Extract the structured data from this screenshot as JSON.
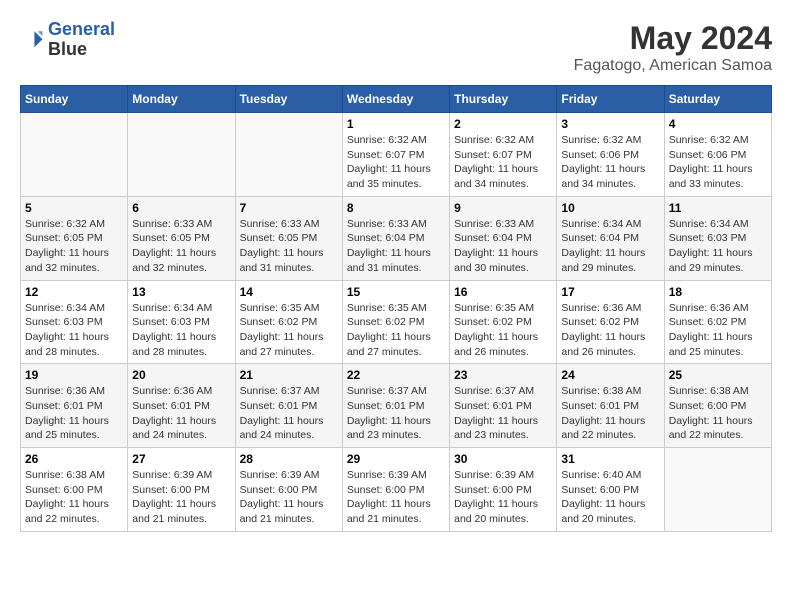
{
  "header": {
    "logo_line1": "General",
    "logo_line2": "Blue",
    "month": "May 2024",
    "location": "Fagatogo, American Samoa"
  },
  "weekdays": [
    "Sunday",
    "Monday",
    "Tuesday",
    "Wednesday",
    "Thursday",
    "Friday",
    "Saturday"
  ],
  "weeks": [
    [
      {
        "day": "",
        "info": ""
      },
      {
        "day": "",
        "info": ""
      },
      {
        "day": "",
        "info": ""
      },
      {
        "day": "1",
        "info": "Sunrise: 6:32 AM\nSunset: 6:07 PM\nDaylight: 11 hours\nand 35 minutes."
      },
      {
        "day": "2",
        "info": "Sunrise: 6:32 AM\nSunset: 6:07 PM\nDaylight: 11 hours\nand 34 minutes."
      },
      {
        "day": "3",
        "info": "Sunrise: 6:32 AM\nSunset: 6:06 PM\nDaylight: 11 hours\nand 34 minutes."
      },
      {
        "day": "4",
        "info": "Sunrise: 6:32 AM\nSunset: 6:06 PM\nDaylight: 11 hours\nand 33 minutes."
      }
    ],
    [
      {
        "day": "5",
        "info": "Sunrise: 6:32 AM\nSunset: 6:05 PM\nDaylight: 11 hours\nand 32 minutes."
      },
      {
        "day": "6",
        "info": "Sunrise: 6:33 AM\nSunset: 6:05 PM\nDaylight: 11 hours\nand 32 minutes."
      },
      {
        "day": "7",
        "info": "Sunrise: 6:33 AM\nSunset: 6:05 PM\nDaylight: 11 hours\nand 31 minutes."
      },
      {
        "day": "8",
        "info": "Sunrise: 6:33 AM\nSunset: 6:04 PM\nDaylight: 11 hours\nand 31 minutes."
      },
      {
        "day": "9",
        "info": "Sunrise: 6:33 AM\nSunset: 6:04 PM\nDaylight: 11 hours\nand 30 minutes."
      },
      {
        "day": "10",
        "info": "Sunrise: 6:34 AM\nSunset: 6:04 PM\nDaylight: 11 hours\nand 29 minutes."
      },
      {
        "day": "11",
        "info": "Sunrise: 6:34 AM\nSunset: 6:03 PM\nDaylight: 11 hours\nand 29 minutes."
      }
    ],
    [
      {
        "day": "12",
        "info": "Sunrise: 6:34 AM\nSunset: 6:03 PM\nDaylight: 11 hours\nand 28 minutes."
      },
      {
        "day": "13",
        "info": "Sunrise: 6:34 AM\nSunset: 6:03 PM\nDaylight: 11 hours\nand 28 minutes."
      },
      {
        "day": "14",
        "info": "Sunrise: 6:35 AM\nSunset: 6:02 PM\nDaylight: 11 hours\nand 27 minutes."
      },
      {
        "day": "15",
        "info": "Sunrise: 6:35 AM\nSunset: 6:02 PM\nDaylight: 11 hours\nand 27 minutes."
      },
      {
        "day": "16",
        "info": "Sunrise: 6:35 AM\nSunset: 6:02 PM\nDaylight: 11 hours\nand 26 minutes."
      },
      {
        "day": "17",
        "info": "Sunrise: 6:36 AM\nSunset: 6:02 PM\nDaylight: 11 hours\nand 26 minutes."
      },
      {
        "day": "18",
        "info": "Sunrise: 6:36 AM\nSunset: 6:02 PM\nDaylight: 11 hours\nand 25 minutes."
      }
    ],
    [
      {
        "day": "19",
        "info": "Sunrise: 6:36 AM\nSunset: 6:01 PM\nDaylight: 11 hours\nand 25 minutes."
      },
      {
        "day": "20",
        "info": "Sunrise: 6:36 AM\nSunset: 6:01 PM\nDaylight: 11 hours\nand 24 minutes."
      },
      {
        "day": "21",
        "info": "Sunrise: 6:37 AM\nSunset: 6:01 PM\nDaylight: 11 hours\nand 24 minutes."
      },
      {
        "day": "22",
        "info": "Sunrise: 6:37 AM\nSunset: 6:01 PM\nDaylight: 11 hours\nand 23 minutes."
      },
      {
        "day": "23",
        "info": "Sunrise: 6:37 AM\nSunset: 6:01 PM\nDaylight: 11 hours\nand 23 minutes."
      },
      {
        "day": "24",
        "info": "Sunrise: 6:38 AM\nSunset: 6:01 PM\nDaylight: 11 hours\nand 22 minutes."
      },
      {
        "day": "25",
        "info": "Sunrise: 6:38 AM\nSunset: 6:00 PM\nDaylight: 11 hours\nand 22 minutes."
      }
    ],
    [
      {
        "day": "26",
        "info": "Sunrise: 6:38 AM\nSunset: 6:00 PM\nDaylight: 11 hours\nand 22 minutes."
      },
      {
        "day": "27",
        "info": "Sunrise: 6:39 AM\nSunset: 6:00 PM\nDaylight: 11 hours\nand 21 minutes."
      },
      {
        "day": "28",
        "info": "Sunrise: 6:39 AM\nSunset: 6:00 PM\nDaylight: 11 hours\nand 21 minutes."
      },
      {
        "day": "29",
        "info": "Sunrise: 6:39 AM\nSunset: 6:00 PM\nDaylight: 11 hours\nand 21 minutes."
      },
      {
        "day": "30",
        "info": "Sunrise: 6:39 AM\nSunset: 6:00 PM\nDaylight: 11 hours\nand 20 minutes."
      },
      {
        "day": "31",
        "info": "Sunrise: 6:40 AM\nSunset: 6:00 PM\nDaylight: 11 hours\nand 20 minutes."
      },
      {
        "day": "",
        "info": ""
      }
    ]
  ]
}
